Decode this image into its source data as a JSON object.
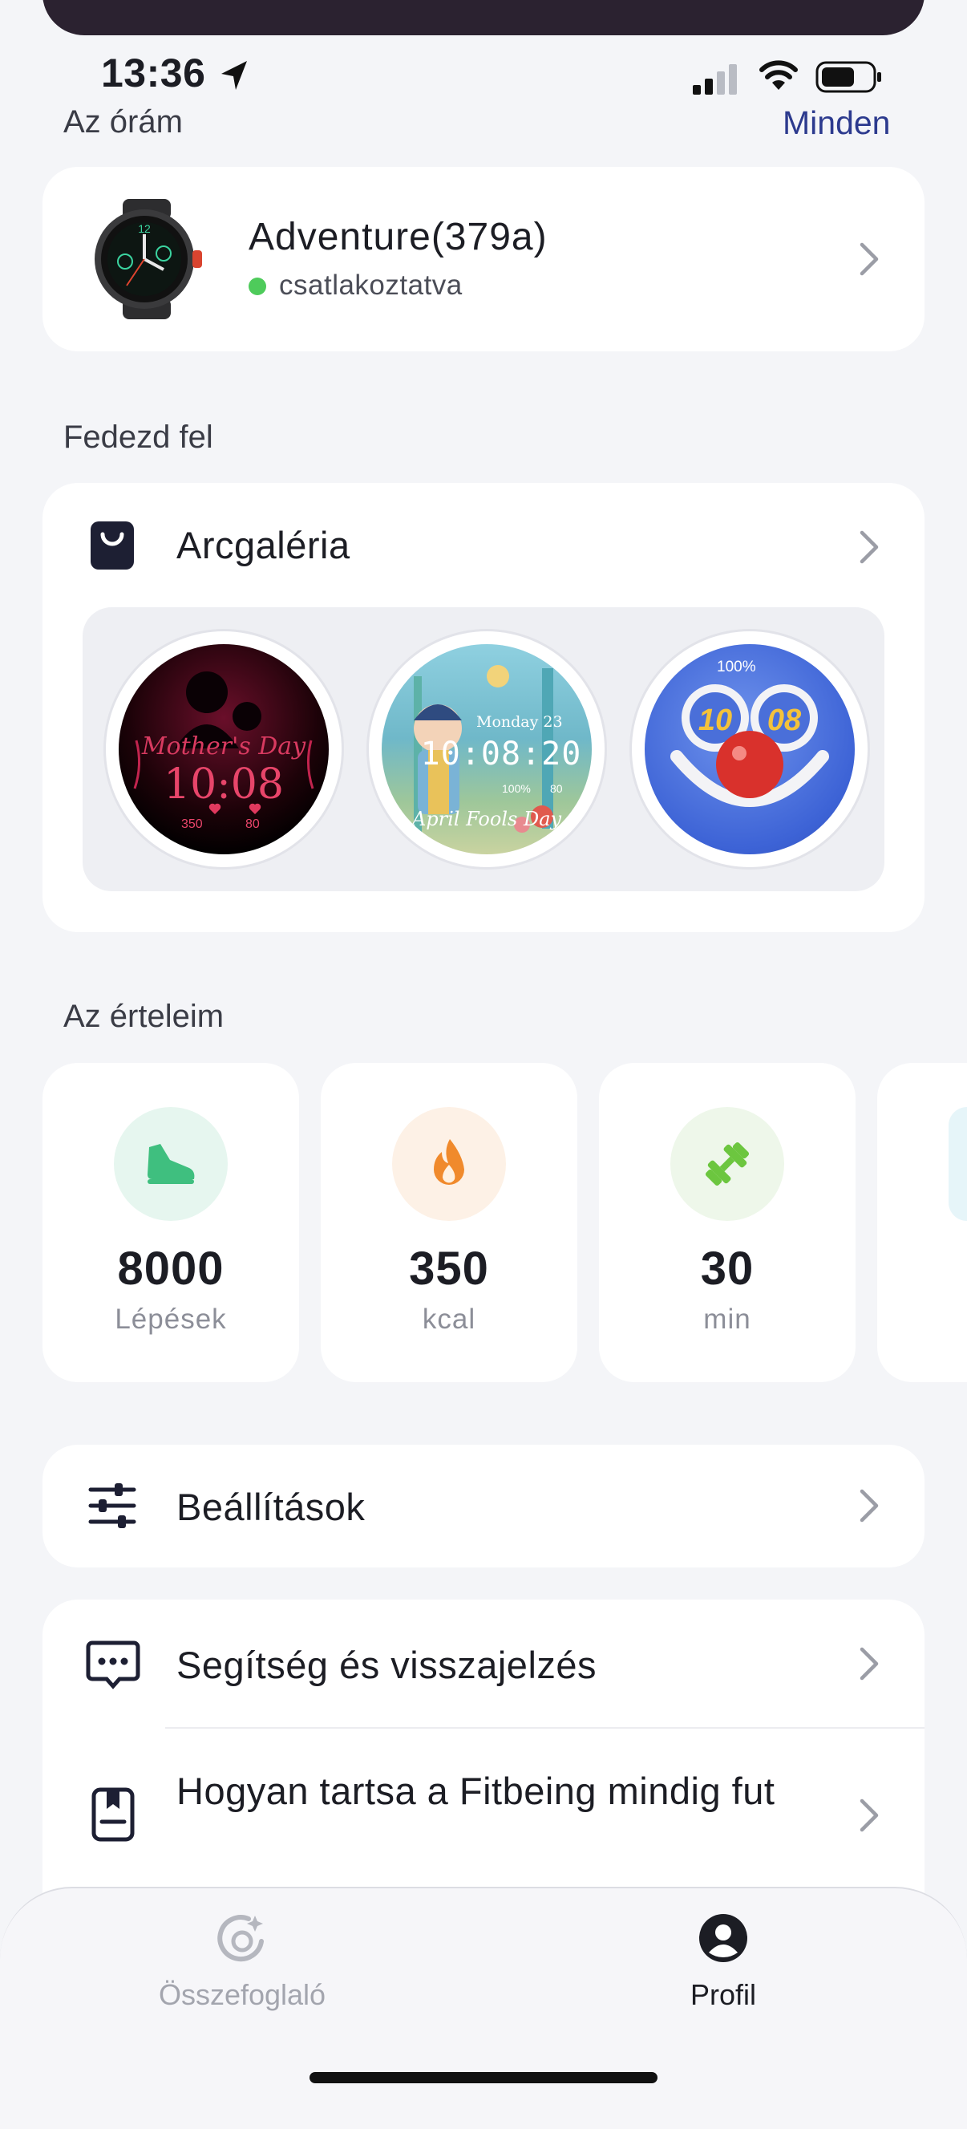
{
  "status_bar": {
    "time": "13:36"
  },
  "header": {
    "title": "Az órám",
    "all_link": "Minden"
  },
  "device": {
    "name": "Adventure(379a)",
    "status": "csatlakoztatva"
  },
  "discover": {
    "section_title": "Fedezd fel",
    "gallery_label": "Arcgaléria",
    "faces": [
      {
        "title": "Mother's Day",
        "time": "10:08",
        "cal": "350",
        "hr": "80"
      },
      {
        "day": "Monday 23",
        "time": "10:08:20",
        "battery": "100%",
        "hr": "80",
        "caption": "April Fools Day"
      },
      {
        "battery": "100%",
        "hour": "10",
        "minute": "08"
      }
    ]
  },
  "metrics": {
    "section_title": "Az érteleim",
    "items": [
      {
        "icon": "shoe-icon",
        "value": "8000",
        "unit": "Lépések",
        "color": "#e6f6ef"
      },
      {
        "icon": "flame-icon",
        "value": "350",
        "unit": "kcal",
        "color": "#fdf1e6"
      },
      {
        "icon": "dumbbell-icon",
        "value": "30",
        "unit": "min",
        "color": "#eef7ea"
      }
    ]
  },
  "menu": {
    "settings": "Beállítások",
    "help": "Segítség és visszajelzés",
    "keep_running": "Hogyan tartsa a Fitbeing mindig fut"
  },
  "tabbar": {
    "summary": "Összefoglaló",
    "profile": "Profil"
  }
}
